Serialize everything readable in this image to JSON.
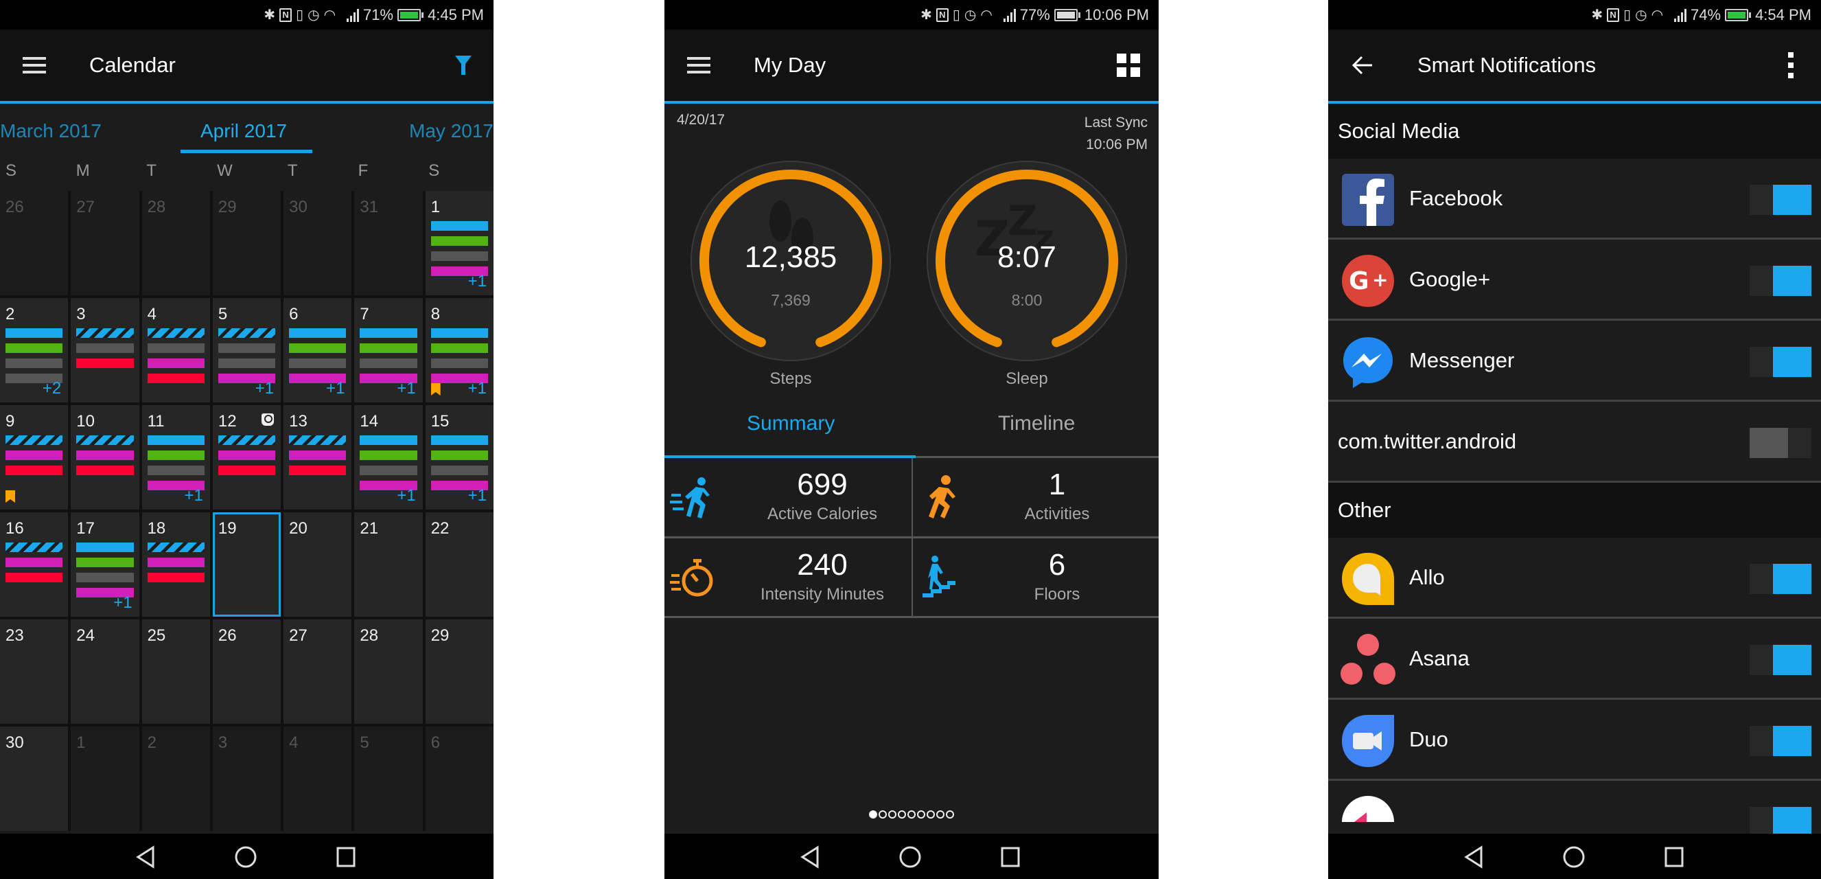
{
  "calendar_screen": {
    "status_bar": {
      "battery": "71%",
      "time": "4:45 PM",
      "charging": true
    },
    "app_bar": {
      "title": "Calendar",
      "menu_icon": "hamburger-icon",
      "action_icon": "filter-icon"
    },
    "months": {
      "prev": "March 2017",
      "current": "April 2017",
      "next": "May 2017"
    },
    "weekdays": [
      "S",
      "M",
      "T",
      "W",
      "T",
      "F",
      "S"
    ],
    "weeks": [
      [
        {
          "day": "26",
          "outside": true,
          "bars": []
        },
        {
          "day": "27",
          "outside": true,
          "bars": []
        },
        {
          "day": "28",
          "outside": true,
          "bars": []
        },
        {
          "day": "29",
          "outside": true,
          "bars": []
        },
        {
          "day": "30",
          "outside": true,
          "bars": []
        },
        {
          "day": "31",
          "outside": true,
          "bars": []
        },
        {
          "day": "1",
          "bars": [
            "blue",
            "green",
            "gray",
            "magenta"
          ],
          "more": "+1"
        }
      ],
      [
        {
          "day": "2",
          "bars": [
            "blue",
            "green",
            "gray",
            "gray"
          ],
          "more": "+2"
        },
        {
          "day": "3",
          "bars": [
            "striped",
            "gray",
            "red"
          ]
        },
        {
          "day": "4",
          "bars": [
            "striped",
            "gray",
            "magenta",
            "red"
          ]
        },
        {
          "day": "5",
          "bars": [
            "striped",
            "gray",
            "gray",
            "magenta"
          ],
          "more": "+1"
        },
        {
          "day": "6",
          "bars": [
            "blue",
            "green",
            "gray",
            "magenta"
          ],
          "more": "+1"
        },
        {
          "day": "7",
          "bars": [
            "blue",
            "green",
            "gray",
            "magenta"
          ],
          "more": "+1"
        },
        {
          "day": "8",
          "bars": [
            "blue",
            "green",
            "gray",
            "magenta"
          ],
          "more": "+1",
          "bookmark": true
        }
      ],
      [
        {
          "day": "9",
          "bars": [
            "striped",
            "magenta",
            "red"
          ],
          "bookmark": true
        },
        {
          "day": "10",
          "bars": [
            "striped",
            "magenta",
            "red"
          ]
        },
        {
          "day": "11",
          "bars": [
            "blue",
            "green",
            "gray",
            "magenta"
          ],
          "more": "+1"
        },
        {
          "day": "12",
          "bars": [
            "striped",
            "magenta",
            "red"
          ],
          "scale": true
        },
        {
          "day": "13",
          "bars": [
            "striped",
            "magenta",
            "red"
          ]
        },
        {
          "day": "14",
          "bars": [
            "blue",
            "green",
            "gray",
            "magenta"
          ],
          "more": "+1"
        },
        {
          "day": "15",
          "bars": [
            "blue",
            "green",
            "gray",
            "magenta"
          ],
          "more": "+1"
        }
      ],
      [
        {
          "day": "16",
          "bars": [
            "striped",
            "magenta",
            "red"
          ]
        },
        {
          "day": "17",
          "bars": [
            "blue",
            "green",
            "gray",
            "magenta"
          ],
          "more": "+1"
        },
        {
          "day": "18",
          "bars": [
            "striped",
            "magenta",
            "red"
          ]
        },
        {
          "day": "19",
          "bars": [],
          "today": true
        },
        {
          "day": "20",
          "bars": []
        },
        {
          "day": "21",
          "bars": []
        },
        {
          "day": "22",
          "bars": []
        }
      ],
      [
        {
          "day": "23",
          "bars": []
        },
        {
          "day": "24",
          "bars": []
        },
        {
          "day": "25",
          "bars": []
        },
        {
          "day": "26",
          "bars": []
        },
        {
          "day": "27",
          "bars": []
        },
        {
          "day": "28",
          "bars": []
        },
        {
          "day": "29",
          "bars": []
        }
      ],
      [
        {
          "day": "30",
          "bars": []
        },
        {
          "day": "1",
          "outside": true,
          "bars": []
        },
        {
          "day": "2",
          "outside": true,
          "bars": []
        },
        {
          "day": "3",
          "outside": true,
          "bars": []
        },
        {
          "day": "4",
          "outside": true,
          "bars": []
        },
        {
          "day": "5",
          "outside": true,
          "bars": []
        },
        {
          "day": "6",
          "outside": true,
          "bars": []
        }
      ]
    ]
  },
  "myday_screen": {
    "status_bar": {
      "battery": "77%",
      "time": "10:06 PM",
      "charging": false
    },
    "app_bar": {
      "title": "My Day",
      "menu_icon": "hamburger-icon",
      "action_icon": "grid-icon"
    },
    "date": "4/20/17",
    "last_sync_label": "Last Sync",
    "last_sync_time": "10:06 PM",
    "gauges": [
      {
        "id": "steps",
        "value": "12,385",
        "goal": "7,369",
        "label": "Steps",
        "progress": 1.0
      },
      {
        "id": "sleep",
        "value": "8:07",
        "goal": "8:00",
        "label": "Sleep",
        "progress": 1.0
      }
    ],
    "tabs": {
      "active": "Summary",
      "inactive": "Timeline"
    },
    "stats": [
      {
        "value": "699",
        "label": "Active Calories",
        "icon": "running-fast-icon",
        "color": "#1aa9ec"
      },
      {
        "value": "1",
        "label": "Activities",
        "icon": "running-icon",
        "color": "#f7931e"
      },
      {
        "value": "240",
        "label": "Intensity Minutes",
        "icon": "stopwatch-icon",
        "color": "#f7931e"
      },
      {
        "value": "6",
        "label": "Floors",
        "icon": "stairs-icon",
        "color": "#1aa9ec"
      }
    ],
    "pager": {
      "count": 9,
      "active": 0
    }
  },
  "notifications_screen": {
    "status_bar": {
      "battery": "74%",
      "time": "4:54 PM",
      "charging": true
    },
    "app_bar": {
      "title": "Smart Notifications",
      "back_icon": "back-arrow-icon",
      "action_icon": "more-vert-icon"
    },
    "sections": [
      {
        "title": "Social Media",
        "items": [
          {
            "name": "Facebook",
            "icon": "facebook-icon",
            "enabled": true
          },
          {
            "name": "Google+",
            "icon": "google-plus-icon",
            "enabled": true
          },
          {
            "name": "Messenger",
            "icon": "messenger-icon",
            "enabled": true
          },
          {
            "name": "com.twitter.android",
            "icon": null,
            "enabled": false
          }
        ]
      },
      {
        "title": "Other",
        "items": [
          {
            "name": "Allo",
            "icon": "allo-icon",
            "enabled": true
          },
          {
            "name": "Asana",
            "icon": "asana-icon",
            "enabled": true
          },
          {
            "name": "Duo",
            "icon": "duo-icon",
            "enabled": true
          },
          {
            "name": "",
            "icon": "partial-app-icon",
            "enabled": true
          }
        ]
      }
    ]
  },
  "colors": {
    "accent": "#1aa3e0",
    "gauge_orange": "#f39200",
    "bar_blue": "#1aa9ec",
    "bar_green": "#52b414",
    "bar_gray": "#555555",
    "bar_magenta": "#d31fb9",
    "bar_red": "#ff0033",
    "bookmark": "#ffa500"
  }
}
